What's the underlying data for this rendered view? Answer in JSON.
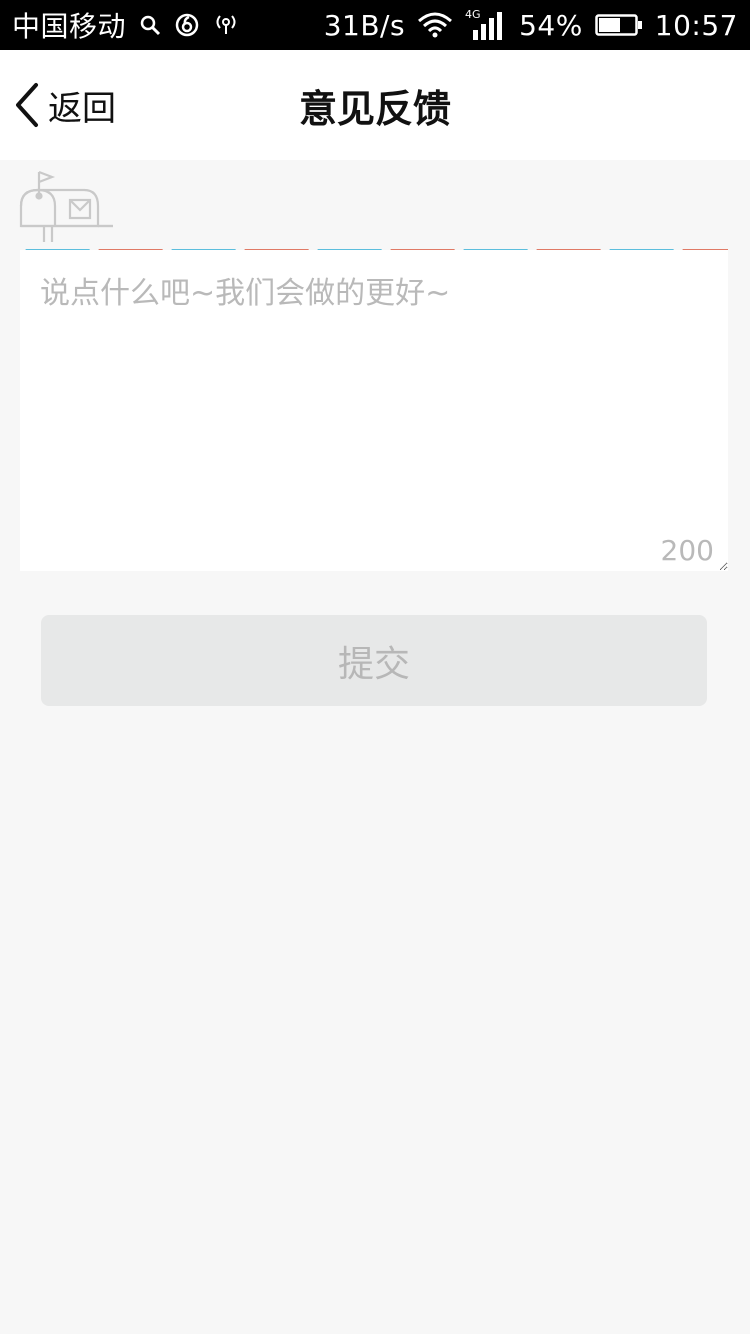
{
  "status_bar": {
    "carrier": "中国移动",
    "net_speed": "31B/s",
    "network_type": "4G",
    "battery": "54%",
    "time": "10:57"
  },
  "nav": {
    "back_label": "返回",
    "title": "意见反馈"
  },
  "feedback": {
    "placeholder": "说点什么吧~我们会做的更好~",
    "value": "",
    "char_limit": "200"
  },
  "submit": {
    "label": "提交"
  },
  "colors": {
    "stripe_blue": "#5cbedd",
    "stripe_red": "#e07a66",
    "button_bg": "#e7e8e8",
    "page_bg": "#f7f7f7"
  }
}
